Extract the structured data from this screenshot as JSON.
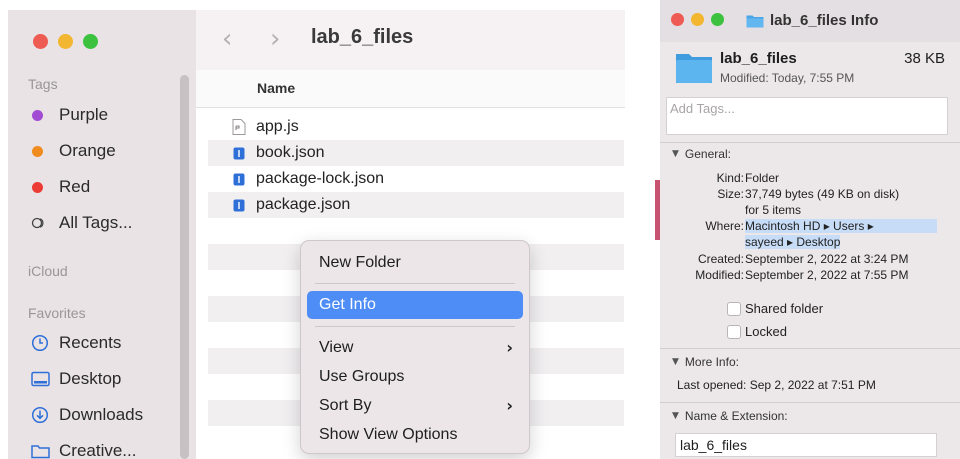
{
  "finder": {
    "title": "lab_6_files",
    "sidebar": {
      "tags_heading": "Tags",
      "tags": [
        {
          "label": "Purple",
          "color": "#a24bd3"
        },
        {
          "label": "Orange",
          "color": "#f08b1d"
        },
        {
          "label": "Red",
          "color": "#ec3b35"
        }
      ],
      "all_tags_label": "All Tags...",
      "icloud_heading": "iCloud",
      "favorites_heading": "Favorites",
      "favorites": [
        {
          "label": "Recents",
          "icon": "clock-icon"
        },
        {
          "label": "Desktop",
          "icon": "desktop-icon"
        },
        {
          "label": "Downloads",
          "icon": "download-icon"
        },
        {
          "label": "Creative...",
          "icon": "folder-icon"
        }
      ]
    },
    "column_header": "Name",
    "files": [
      {
        "name": "app.js",
        "icon": "script-file-icon"
      },
      {
        "name": "book.json",
        "icon": "json-file-icon"
      },
      {
        "name": "package-lock.json",
        "icon": "json-file-icon"
      },
      {
        "name": "package.json",
        "icon": "json-file-icon"
      }
    ]
  },
  "context_menu": {
    "new_folder": "New Folder",
    "get_info": "Get Info",
    "view": "View",
    "use_groups": "Use Groups",
    "sort_by": "Sort By",
    "show_view_options": "Show View Options",
    "submenu_arrow": "›"
  },
  "info": {
    "window_title": "lab_6_files Info",
    "name": "lab_6_files",
    "size": "38 KB",
    "modified_summary": "Modified: Today, 7:55 PM",
    "tags_placeholder": "Add Tags...",
    "general_label": "General:",
    "kind_label": "Kind:",
    "kind_value": "Folder",
    "size_label": "Size:",
    "size_value": "37,749 bytes (49 KB on disk)",
    "size_items": "for 5 items",
    "where_label": "Where:",
    "where_line1": "Macintosh HD ▸ Users ▸",
    "where_line2": "sayeed ▸ Desktop",
    "created_label": "Created:",
    "created_value": "September 2, 2022 at 3:24 PM",
    "modified_label": "Modified:",
    "modified_value": "September 2, 2022 at 7:55 PM",
    "shared_folder_label": "Shared folder",
    "locked_label": "Locked",
    "more_info_label": "More Info:",
    "last_opened": "Last opened: Sep 2, 2022 at 7:51 PM",
    "name_ext_label": "Name & Extension:",
    "name_field_value": "lab_6_files"
  }
}
